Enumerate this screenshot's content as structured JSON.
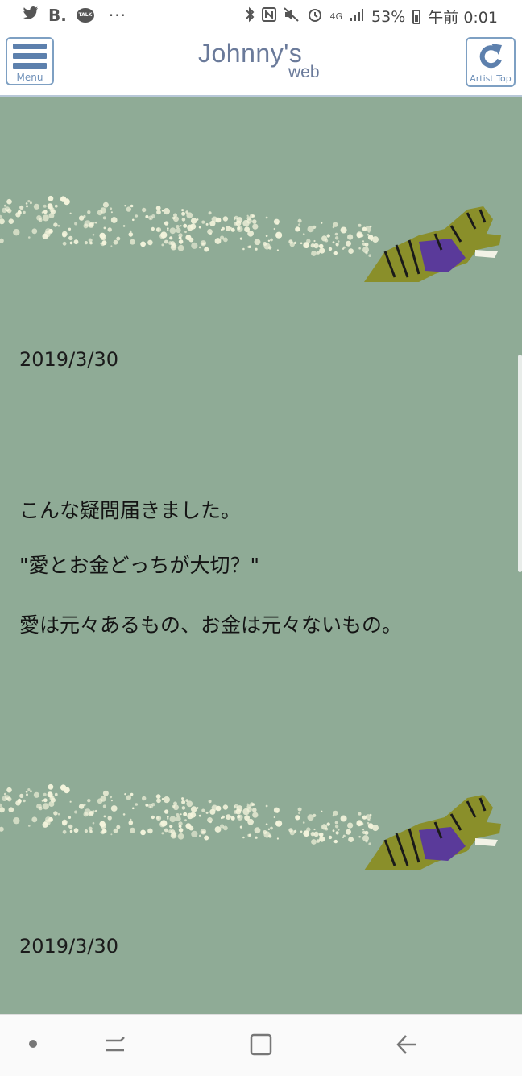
{
  "status_bar": {
    "left_icons": [
      "twitter-icon",
      "b-icon",
      "talk-icon",
      "more-icon"
    ],
    "b_label": "B.",
    "talk_label": "TALK",
    "more_label": "···",
    "battery_percent": "53%",
    "time": "午前 0:01",
    "network": "4G"
  },
  "header": {
    "menu_label": "Menu",
    "logo_main": "Johnny's",
    "logo_sub": "web",
    "artist_top_label": "Artist Top"
  },
  "colors": {
    "content_bg": "#8fab96",
    "accent": "#5d80ad",
    "sparkle": "#f4f4dc"
  },
  "posts": [
    {
      "date": "2019/3/30",
      "lines": [
        "こんな疑問届きました。",
        "\"愛とお金どっちが大切？\"",
        "愛は元々あるもの、お金は元々ないもの。"
      ]
    },
    {
      "date": "2019/3/30",
      "lines": []
    }
  ]
}
